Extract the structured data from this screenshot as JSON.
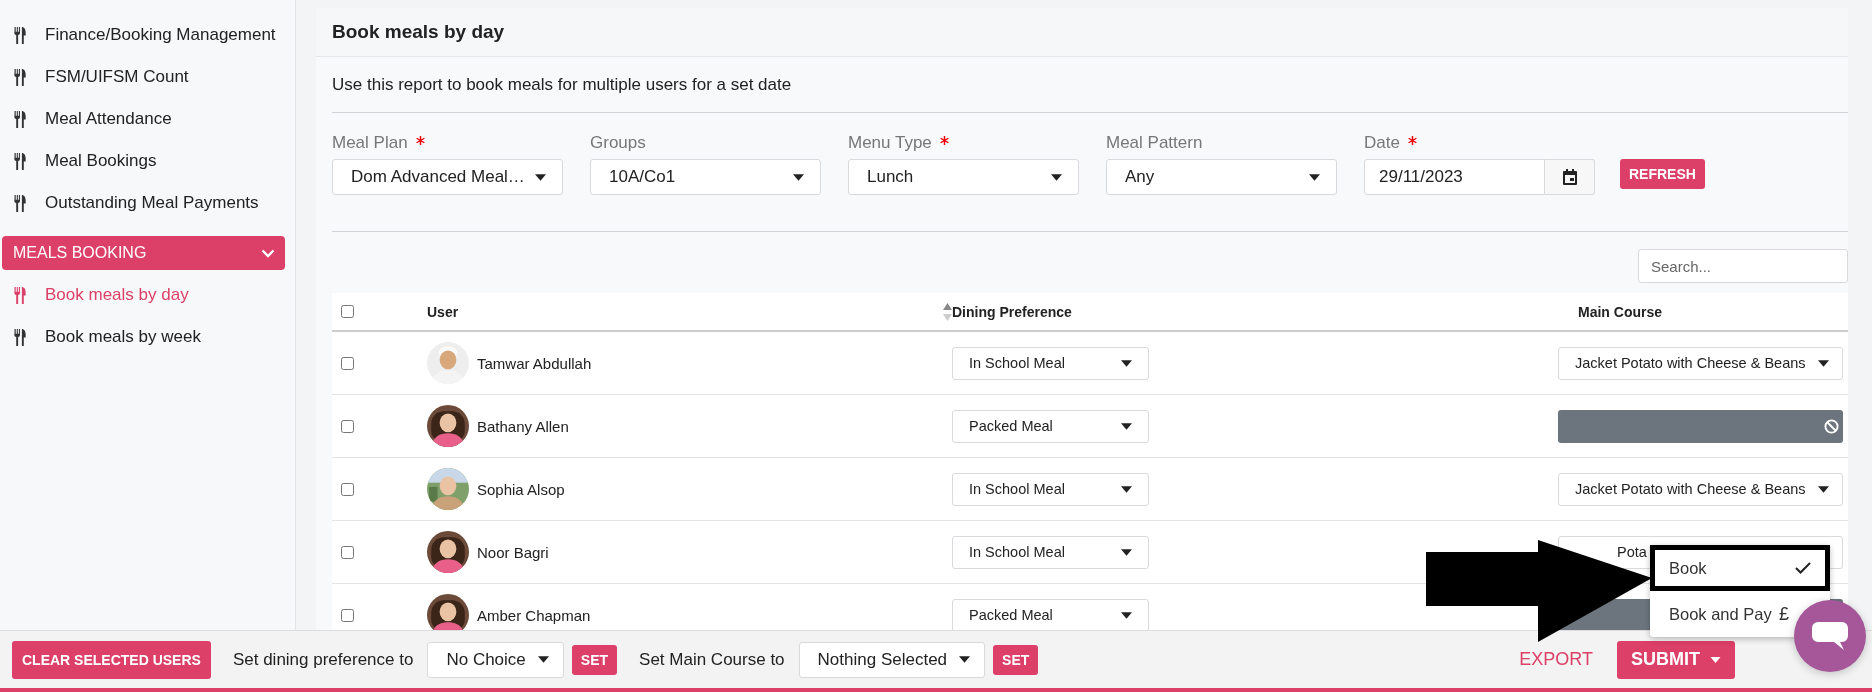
{
  "sidebar": {
    "items": [
      {
        "label": "Finance/Booking Management",
        "selected": false
      },
      {
        "label": "FSM/UIFSM Count",
        "selected": false
      },
      {
        "label": "Meal Attendance",
        "selected": false
      },
      {
        "label": "Meal Bookings",
        "selected": false
      },
      {
        "label": "Outstanding Meal Payments",
        "selected": false
      }
    ],
    "section": {
      "label": "MEALS BOOKING",
      "expanded": true,
      "items": [
        {
          "label": "Book meals by day",
          "selected": true
        },
        {
          "label": "Book meals by week",
          "selected": false
        }
      ]
    }
  },
  "page": {
    "title": "Book meals by day",
    "description": "Use this report to book meals for multiple users for a set date"
  },
  "filters": [
    {
      "kind": "select",
      "label": "Meal Plan",
      "required": true,
      "value": "Dom Advanced Meal…"
    },
    {
      "kind": "select",
      "label": "Groups",
      "required": false,
      "value": "10A/Co1"
    },
    {
      "kind": "select",
      "label": "Menu Type",
      "required": true,
      "value": "Lunch"
    },
    {
      "kind": "select",
      "label": "Meal Pattern",
      "required": false,
      "value": "Any"
    },
    {
      "kind": "date",
      "label": "Date",
      "required": true,
      "value": "29/11/2023"
    }
  ],
  "refresh_button": "REFRESH",
  "search": {
    "placeholder": "Search..."
  },
  "table": {
    "select_all_checked": false,
    "columns": [
      {
        "label": "User",
        "sortable": true
      },
      {
        "label": "Dining Preference",
        "sortable": false
      },
      {
        "label": "Main Course",
        "sortable": false
      }
    ],
    "rows": [
      {
        "checked": false,
        "user": "Tamwar Abdullah",
        "dining_preference": "In School Meal",
        "main_course": {
          "kind": "select",
          "value": "Jacket Potato with Cheese & Beans"
        }
      },
      {
        "checked": false,
        "user": "Bathany Allen",
        "dining_preference": "Packed Meal",
        "main_course": {
          "kind": "disabled"
        }
      },
      {
        "checked": false,
        "user": "Sophia Alsop",
        "dining_preference": "In School Meal",
        "main_course": {
          "kind": "select",
          "value": "Jacket Potato with Cheese & Beans"
        }
      },
      {
        "checked": false,
        "user": "Noor Bagri",
        "dining_preference": "In School Meal",
        "main_course": {
          "kind": "obscured",
          "value": "Pota"
        }
      },
      {
        "checked": false,
        "user": "Amber Chapman",
        "dining_preference": "Packed Meal",
        "main_course": {
          "kind": "covered"
        }
      }
    ]
  },
  "bottom_bar": {
    "clear_button": "CLEAR SELECTED USERS",
    "dining_label": "Set dining preference to",
    "dining_value": "No Choice",
    "dining_set": "SET",
    "course_label": "Set Main Course to",
    "course_value": "Nothing Selected",
    "course_set": "SET",
    "export": "EXPORT",
    "submit": "SUBMIT"
  },
  "submit_menu": {
    "items": [
      {
        "label": "Book",
        "kind": "check",
        "selected": true
      },
      {
        "label": "Book and Pay",
        "kind": "currency",
        "symbol": "£",
        "selected": false
      }
    ]
  }
}
